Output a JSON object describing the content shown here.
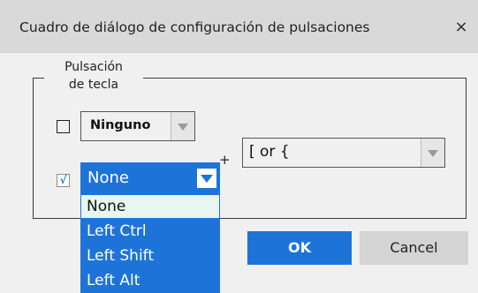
{
  "dialog": {
    "title": "Cuadro de diálogo de configuración de pulsaciones",
    "close_glyph": "×"
  },
  "group": {
    "legend_line1": "Pulsación",
    "legend_line2": "de tecla"
  },
  "row1": {
    "checkbox_checked": false,
    "modifier_value": "Ninguno"
  },
  "plus_sign": "+",
  "key_combo": {
    "value": "[ or {"
  },
  "row2": {
    "checkbox_checked": true,
    "checkbox_glyph": "√",
    "modifier_value": "None",
    "options": [
      "None",
      "Left Ctrl",
      "Left Shift",
      "Left Alt"
    ],
    "highlighted_option": "None"
  },
  "buttons": {
    "ok": "OK",
    "cancel": "Cancel"
  },
  "colors": {
    "accent": "#1e73d8",
    "titlebar": "#d9d9d9",
    "background": "#f0f0f0",
    "hover_option": "#e8f6f1"
  }
}
